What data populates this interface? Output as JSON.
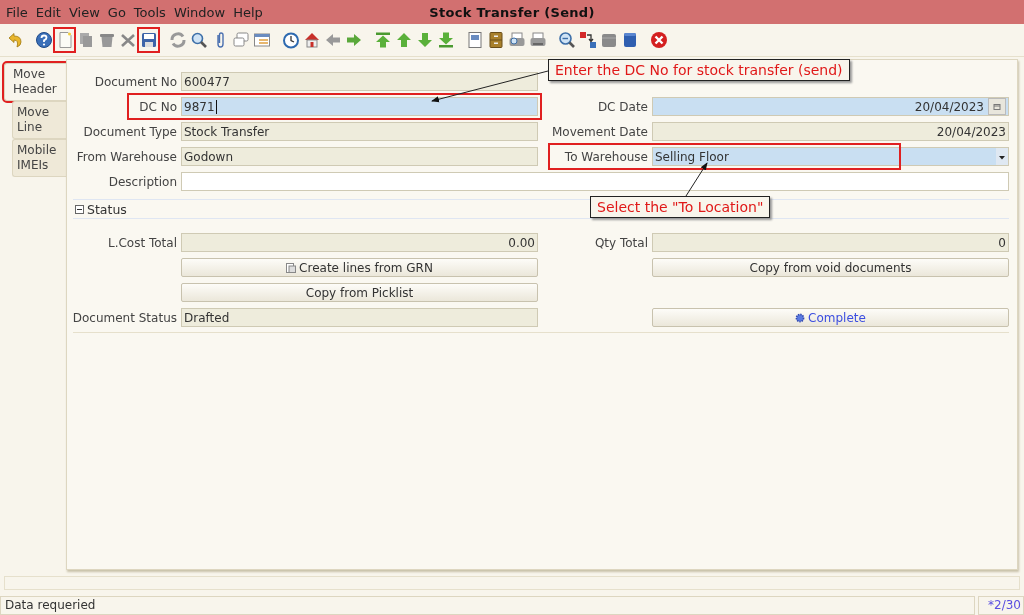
{
  "window": {
    "title": "Stock Transfer (Send)"
  },
  "menus": [
    "File",
    "Edit",
    "View",
    "Go",
    "Tools",
    "Window",
    "Help"
  ],
  "toolbar": [
    {
      "kind": "undo",
      "highlighted": false
    },
    {
      "kind": "help",
      "highlighted": false
    },
    {
      "kind": "new",
      "highlighted": true
    },
    {
      "kind": "copy",
      "highlighted": false
    },
    {
      "kind": "trash",
      "highlighted": false
    },
    {
      "kind": "x",
      "highlighted": false
    },
    {
      "kind": "save",
      "highlighted": true
    },
    {
      "kind": "refresh",
      "highlighted": false
    },
    {
      "kind": "find",
      "highlighted": false
    },
    {
      "kind": "attach",
      "highlighted": false
    },
    {
      "kind": "chat",
      "highlighted": false
    },
    {
      "kind": "grid",
      "highlighted": false
    },
    {
      "kind": "history",
      "highlighted": false
    },
    {
      "kind": "home",
      "highlighted": false
    },
    {
      "kind": "back",
      "highlighted": false
    },
    {
      "kind": "forward",
      "highlighted": false
    },
    {
      "kind": "first",
      "highlighted": false
    },
    {
      "kind": "up",
      "highlighted": false
    },
    {
      "kind": "down",
      "highlighted": false
    },
    {
      "kind": "last",
      "highlighted": false
    },
    {
      "kind": "report",
      "highlighted": false
    },
    {
      "kind": "archive",
      "highlighted": false
    },
    {
      "kind": "preview",
      "highlighted": false
    },
    {
      "kind": "print",
      "highlighted": false
    },
    {
      "kind": "zoom",
      "highlighted": false
    },
    {
      "kind": "request",
      "highlighted": false
    },
    {
      "kind": "product",
      "highlighted": false
    },
    {
      "kind": "cube",
      "highlighted": false
    },
    {
      "kind": "close",
      "highlighted": false
    }
  ],
  "tabs": [
    {
      "label": "Move Header",
      "selected": true,
      "highlighted": true
    },
    {
      "label": "Move Line",
      "selected": false,
      "highlighted": false
    },
    {
      "label": "Mobile IMEIs",
      "selected": false,
      "highlighted": false
    }
  ],
  "header_rows": [
    [
      {
        "label": "Document No",
        "value": "600477",
        "kind": "text",
        "mandatory": false,
        "highlighted": false,
        "focused": false
      }
    ],
    [
      {
        "label": "DC No",
        "value": "9871",
        "kind": "text",
        "mandatory": true,
        "highlighted": true,
        "focused": true
      },
      {
        "label": "DC Date",
        "value": "20/04/2023",
        "kind": "date",
        "mandatory": true,
        "highlighted": false,
        "focused": false
      }
    ],
    [
      {
        "label": "Document Type",
        "value": "Stock Transfer",
        "kind": "text",
        "mandatory": false,
        "highlighted": false,
        "focused": false
      },
      {
        "label": "Movement Date",
        "value": "20/04/2023",
        "kind": "number",
        "mandatory": false,
        "highlighted": false,
        "focused": false
      }
    ],
    [
      {
        "label": "From Warehouse",
        "value": "Godown",
        "kind": "text",
        "mandatory": false,
        "highlighted": false,
        "focused": false
      },
      {
        "label": "To Warehouse",
        "value": "Selling Floor",
        "kind": "combo",
        "mandatory": true,
        "highlighted": true,
        "focused": false
      }
    ],
    [
      {
        "label": "Description",
        "kind": "memo",
        "mandatory": false,
        "highlighted": false,
        "focused": false
      }
    ]
  ],
  "status_section": {
    "title": "Status",
    "expanded": true,
    "rows": [
      [
        {
          "label": "L.Cost Total",
          "value": "0.00",
          "kind": "number",
          "mandatory": false,
          "highlighted": false,
          "focused": false
        },
        {
          "label": "Qty Total",
          "value": "0",
          "kind": "number",
          "mandatory": false,
          "highlighted": false,
          "focused": false
        }
      ],
      [
        {
          "label": "Create lines from GRN",
          "kind": "generate_button"
        },
        {
          "label": "Copy from void documents",
          "kind": "button"
        }
      ],
      [
        {
          "label": "Copy from Picklist",
          "kind": "button"
        }
      ],
      [
        {
          "label": "Document Status",
          "value": "Drafted",
          "kind": "text",
          "mandatory": false,
          "highlighted": false,
          "focused": false
        },
        {
          "label": "Complete",
          "kind": "process_button"
        }
      ]
    ]
  },
  "callouts": [
    {
      "text": "Enter the DC No for stock transfer (send)"
    },
    {
      "text": "Select the \"To Location\""
    }
  ],
  "status_bar": {
    "message": "Data requeried",
    "record": "*2/30"
  }
}
